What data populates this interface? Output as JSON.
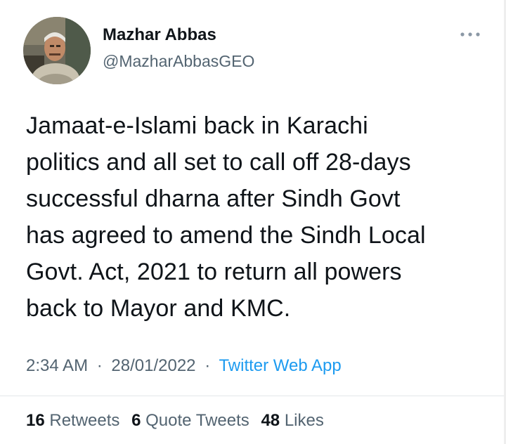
{
  "author": {
    "display_name": "Mazhar Abbas",
    "handle": "@MazharAbbasGEO"
  },
  "tweet": {
    "text_lines": [
      "Jamaat-e-Islami back in Karachi",
      "politics and all set to call off 28-days",
      "successful dharna after Sindh Govt",
      "has agreed to amend the Sindh Local",
      "Govt. Act, 2021 to return all powers",
      "back to Mayor and KMC."
    ]
  },
  "meta": {
    "time": "2:34 AM",
    "separator": "·",
    "date": "28/01/2022",
    "source": "Twitter Web App"
  },
  "stats": {
    "retweets_count": "16",
    "retweets_label": "Retweets",
    "quotes_count": "6",
    "quotes_label": "Quote Tweets",
    "likes_count": "48",
    "likes_label": "Likes"
  },
  "icons": {
    "more": "more-horizontal-icon",
    "avatar": "profile-photo"
  },
  "colors": {
    "primary_text": "#0f1419",
    "secondary_text": "#536471",
    "link": "#1d9bf0"
  }
}
